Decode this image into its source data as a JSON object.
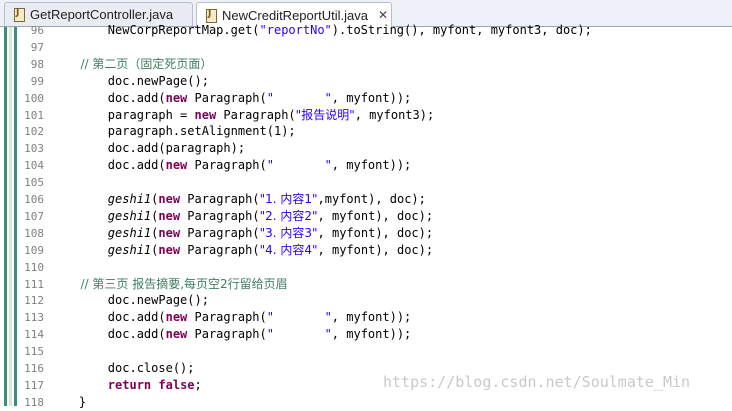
{
  "tabs": [
    {
      "label": "GetReportController.java",
      "icon": "java-file-icon",
      "active": false
    },
    {
      "label": "NewCreditReportUtil.java",
      "icon": "java-file-icon",
      "active": true,
      "close": "✕"
    }
  ],
  "gutter": {
    "colors": [
      "#3a8f7a",
      "#d9e8d2",
      "#3a8f7a"
    ]
  },
  "code_lines": [
    {
      "num": "96",
      "segments": [
        {
          "t": "        NewCorpReportMap.get(",
          "c": "plain"
        },
        {
          "t": "\"reportNo\"",
          "c": "str"
        },
        {
          "t": ").toString(), myfont, myfont3, doc);",
          "c": "plain"
        }
      ]
    },
    {
      "num": "97",
      "segments": []
    },
    {
      "num": "98",
      "segments": [
        {
          "t": "        // 第二页（固定死页面）",
          "c": "cm"
        }
      ]
    },
    {
      "num": "99",
      "segments": [
        {
          "t": "        doc.newPage();",
          "c": "plain"
        }
      ]
    },
    {
      "num": "100",
      "segments": [
        {
          "t": "        doc.add(",
          "c": "plain"
        },
        {
          "t": "new",
          "c": "kw"
        },
        {
          "t": " Paragraph(",
          "c": "plain"
        },
        {
          "t": "\"       \"",
          "c": "str"
        },
        {
          "t": ", myfont));",
          "c": "plain"
        }
      ]
    },
    {
      "num": "101",
      "segments": [
        {
          "t": "        paragraph = ",
          "c": "plain"
        },
        {
          "t": "new",
          "c": "kw"
        },
        {
          "t": " Paragraph(",
          "c": "plain"
        },
        {
          "t": "\"报告说明\"",
          "c": "str"
        },
        {
          "t": ", myfont3);",
          "c": "plain"
        }
      ]
    },
    {
      "num": "102",
      "segments": [
        {
          "t": "        paragraph.setAlignment(1);",
          "c": "plain"
        }
      ]
    },
    {
      "num": "103",
      "segments": [
        {
          "t": "        doc.add(paragraph);",
          "c": "plain"
        }
      ]
    },
    {
      "num": "104",
      "segments": [
        {
          "t": "        doc.add(",
          "c": "plain"
        },
        {
          "t": "new",
          "c": "kw"
        },
        {
          "t": " Paragraph(",
          "c": "plain"
        },
        {
          "t": "\"       \"",
          "c": "str"
        },
        {
          "t": ", myfont));",
          "c": "plain"
        }
      ]
    },
    {
      "num": "105",
      "segments": []
    },
    {
      "num": "106",
      "segments": [
        {
          "t": "        ",
          "c": "plain"
        },
        {
          "t": "geshi1",
          "c": "it"
        },
        {
          "t": "(",
          "c": "plain"
        },
        {
          "t": "new",
          "c": "kw"
        },
        {
          "t": " Paragraph(",
          "c": "plain"
        },
        {
          "t": "\"1. 内容1\"",
          "c": "str"
        },
        {
          "t": ",myfont), doc);",
          "c": "plain"
        }
      ]
    },
    {
      "num": "107",
      "segments": [
        {
          "t": "        ",
          "c": "plain"
        },
        {
          "t": "geshi1",
          "c": "it"
        },
        {
          "t": "(",
          "c": "plain"
        },
        {
          "t": "new",
          "c": "kw"
        },
        {
          "t": " Paragraph(",
          "c": "plain"
        },
        {
          "t": "\"2. 内容2\"",
          "c": "str"
        },
        {
          "t": ", myfont), doc);",
          "c": "plain"
        }
      ]
    },
    {
      "num": "108",
      "segments": [
        {
          "t": "        ",
          "c": "plain"
        },
        {
          "t": "geshi1",
          "c": "it"
        },
        {
          "t": "(",
          "c": "plain"
        },
        {
          "t": "new",
          "c": "kw"
        },
        {
          "t": " Paragraph(",
          "c": "plain"
        },
        {
          "t": "\"3. 内容3\"",
          "c": "str"
        },
        {
          "t": ", myfont), doc);",
          "c": "plain"
        }
      ]
    },
    {
      "num": "109",
      "segments": [
        {
          "t": "        ",
          "c": "plain"
        },
        {
          "t": "geshi1",
          "c": "it"
        },
        {
          "t": "(",
          "c": "plain"
        },
        {
          "t": "new",
          "c": "kw"
        },
        {
          "t": " Paragraph(",
          "c": "plain"
        },
        {
          "t": "\"4. 内容4\"",
          "c": "str"
        },
        {
          "t": ", myfont), doc);",
          "c": "plain"
        }
      ]
    },
    {
      "num": "110",
      "segments": []
    },
    {
      "num": "111",
      "segments": [
        {
          "t": "        // 第三页 报告摘要,每页空2行留给页眉",
          "c": "cm"
        }
      ]
    },
    {
      "num": "112",
      "segments": [
        {
          "t": "        doc.newPage();",
          "c": "plain"
        }
      ]
    },
    {
      "num": "113",
      "segments": [
        {
          "t": "        doc.add(",
          "c": "plain"
        },
        {
          "t": "new",
          "c": "kw"
        },
        {
          "t": " Paragraph(",
          "c": "plain"
        },
        {
          "t": "\"       \"",
          "c": "str"
        },
        {
          "t": ", myfont));",
          "c": "plain"
        }
      ]
    },
    {
      "num": "114",
      "segments": [
        {
          "t": "        doc.add(",
          "c": "plain"
        },
        {
          "t": "new",
          "c": "kw"
        },
        {
          "t": " Paragraph(",
          "c": "plain"
        },
        {
          "t": "\"       \"",
          "c": "str"
        },
        {
          "t": ", myfont));",
          "c": "plain"
        }
      ]
    },
    {
      "num": "115",
      "segments": []
    },
    {
      "num": "116",
      "segments": [
        {
          "t": "        doc.close();",
          "c": "plain"
        }
      ]
    },
    {
      "num": "117",
      "segments": [
        {
          "t": "        ",
          "c": "plain"
        },
        {
          "t": "return",
          "c": "kw"
        },
        {
          "t": " ",
          "c": "plain"
        },
        {
          "t": "false",
          "c": "kw"
        },
        {
          "t": ";",
          "c": "plain"
        }
      ]
    },
    {
      "num": "118",
      "segments": [
        {
          "t": "    }",
          "c": "plain"
        }
      ]
    }
  ],
  "watermark": "https://blog.csdn.net/Soulmate_Min"
}
